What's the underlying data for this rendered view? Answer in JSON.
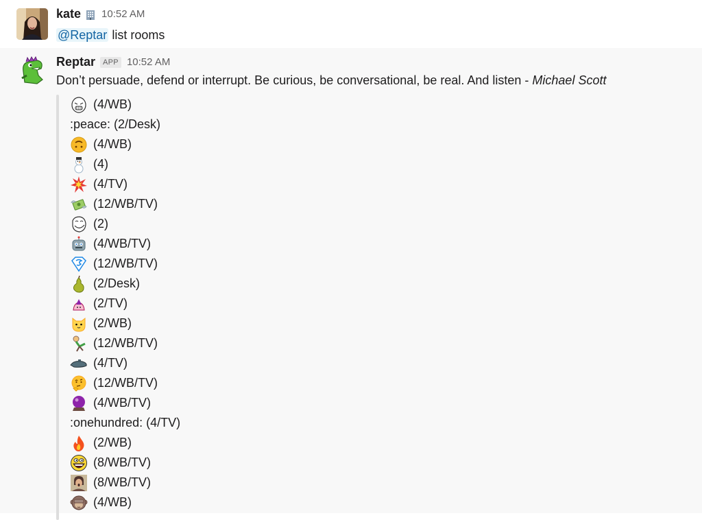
{
  "messages": [
    {
      "username": "kate",
      "timestamp": "10:52 AM",
      "mention": "@Reptar",
      "text": "list rooms"
    },
    {
      "username": "Reptar",
      "badge": "APP",
      "timestamp": "10:52 AM",
      "quote": "Don’t persuade, defend or interrupt. Be curious, be conversational, be real. And listen -",
      "quote_author": "Michael Scott",
      "rooms": [
        {
          "icon": "rage-face-icon",
          "text": "(4/WB)"
        },
        {
          "icon": "",
          "text": ":peace: (2/Desk)"
        },
        {
          "icon": "upside-down-face-icon",
          "text": "(4/WB)"
        },
        {
          "icon": "snowman-icon",
          "text": "(4)"
        },
        {
          "icon": "boom-icon",
          "text": "(4/TV)"
        },
        {
          "icon": "money-wings-icon",
          "text": "(12/WB/TV)"
        },
        {
          "icon": "troll-face-icon",
          "text": "(2)"
        },
        {
          "icon": "robot-icon",
          "text": "(4/WB/TV)"
        },
        {
          "icon": "superman-icon",
          "text": "(12/WB/TV)"
        },
        {
          "icon": "pear-icon",
          "text": "(2/Desk)"
        },
        {
          "icon": "party-hat-icon",
          "text": "(2/TV)"
        },
        {
          "icon": "cat-face-icon",
          "text": "(2/WB)"
        },
        {
          "icon": "dancing-man-icon",
          "text": "(12/WB/TV)"
        },
        {
          "icon": "submarine-icon",
          "text": "(4/TV)"
        },
        {
          "icon": "thinking-face-icon",
          "text": "(12/WB/TV)"
        },
        {
          "icon": "crystal-ball-icon",
          "text": "(4/WB/TV)"
        },
        {
          "icon": "",
          "text": ":onehundred: (4/TV)"
        },
        {
          "icon": "fire-icon",
          "text": "(2/WB)"
        },
        {
          "icon": "awesome-face-icon",
          "text": "(8/WB/TV)"
        },
        {
          "icon": "shocked-man-icon",
          "text": "(8/WB/TV)"
        },
        {
          "icon": "see-no-evil-monkey-icon",
          "text": "(4/WB)"
        }
      ]
    }
  ],
  "colors": {
    "mention_text": "#1264a3",
    "mention_bg": "#e8f5fa",
    "hover_bg": "#f8f8f8",
    "timestamp": "#616061"
  }
}
